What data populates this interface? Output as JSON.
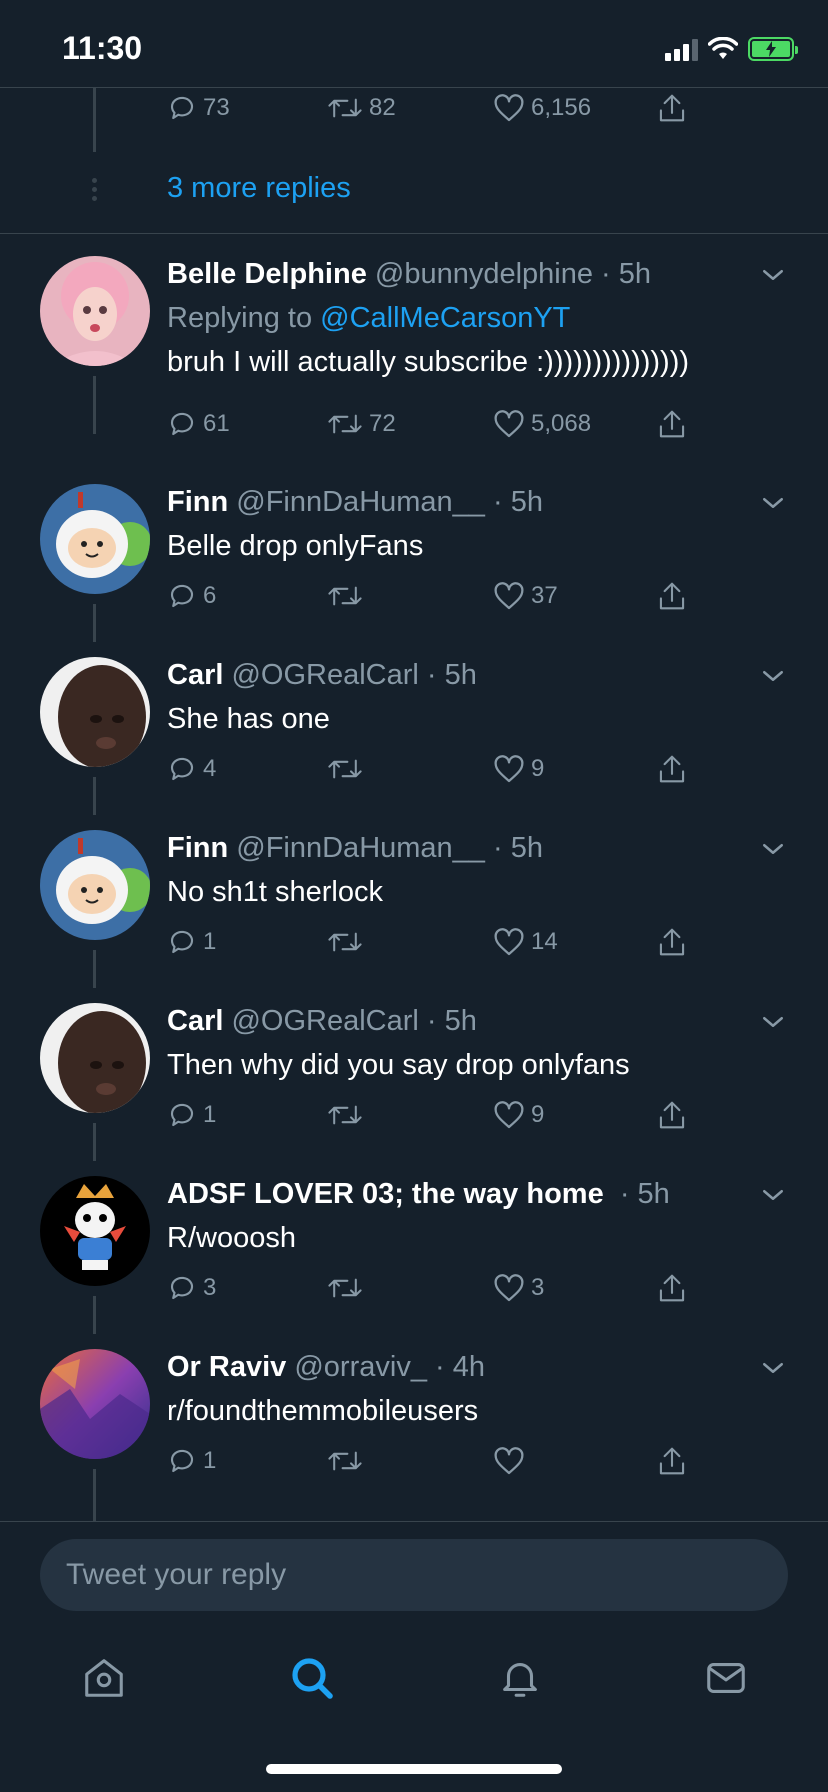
{
  "status_bar": {
    "time": "11:30"
  },
  "top_partial": {
    "reply_count": "73",
    "retweet_count": "82",
    "like_count": "6,156",
    "more_replies": "3 more replies"
  },
  "tweets": [
    {
      "name": "Belle Delphine",
      "handle": "@bunnydelphine",
      "dot": "·",
      "time": "5h",
      "replying_prefix": "Replying to ",
      "replying_handle": "@CallMeCarsonYT",
      "text": "bruh I will actually subscribe :)))))))))))))))",
      "replies": "61",
      "retweets": "72",
      "likes": "5,068"
    },
    {
      "name": "Finn",
      "handle": "@FinnDaHuman__",
      "dot": "·",
      "time": "5h",
      "text": "Belle drop onlyFans",
      "replies": "6",
      "retweets": "",
      "likes": "37"
    },
    {
      "name": "Carl",
      "handle": "@OGRealCarl",
      "dot": "·",
      "time": "5h",
      "text": "She has one",
      "replies": "4",
      "retweets": "",
      "likes": "9"
    },
    {
      "name": "Finn",
      "handle": "@FinnDaHuman__",
      "dot": "·",
      "time": "5h",
      "text": "No sh1t sherlock",
      "replies": "1",
      "retweets": "",
      "likes": "14"
    },
    {
      "name": "Carl",
      "handle": "@OGRealCarl",
      "dot": "·",
      "time": "5h",
      "text": "Then why did you say drop onlyfans",
      "replies": "1",
      "retweets": "",
      "likes": "9"
    },
    {
      "name": "ADSF LOVER 03; the way home",
      "handle": "",
      "dot": "·",
      "time": "5h",
      "text": "R/wooosh",
      "replies": "3",
      "retweets": "",
      "likes": "3"
    },
    {
      "name": "Or Raviv",
      "handle": "@orraviv_",
      "dot": "·",
      "time": "4h",
      "text": "r/foundthemmobileusers",
      "replies": "1",
      "retweets": "",
      "likes": ""
    }
  ],
  "reply_box": {
    "placeholder": "Tweet your reply"
  },
  "tab_bar": {
    "icons": [
      "home-icon",
      "search-icon",
      "notifications-icon",
      "messages-icon"
    ],
    "active": "search-icon"
  },
  "colors": {
    "background": "#15202b",
    "accent": "#1da1f2",
    "muted": "#8899a6",
    "divider": "#38444d"
  }
}
